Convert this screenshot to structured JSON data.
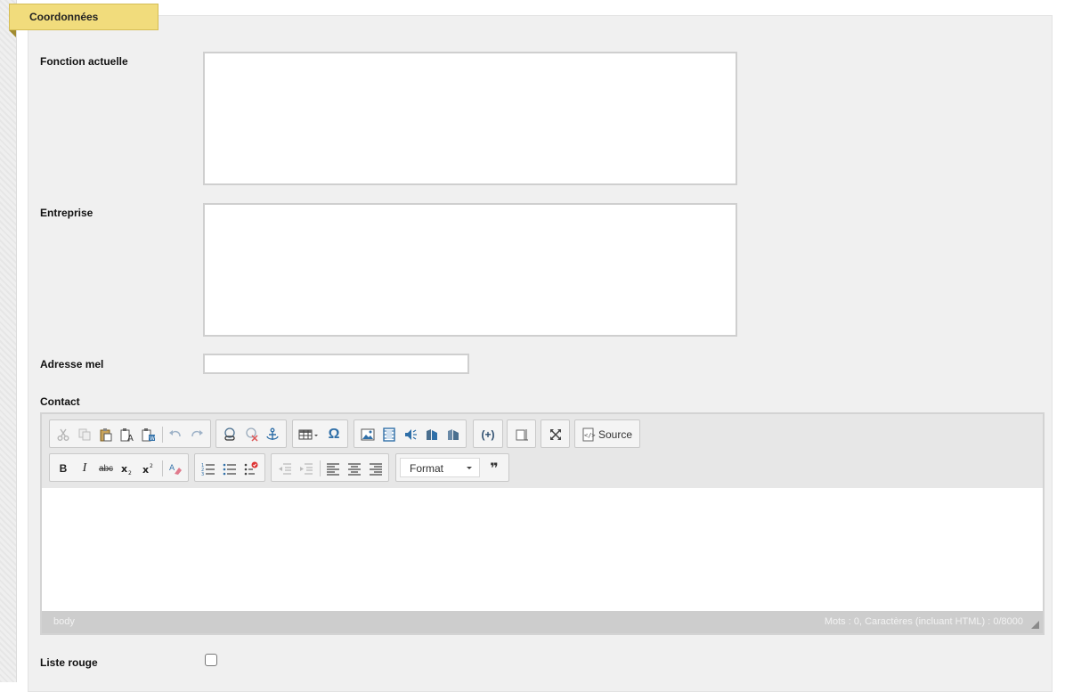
{
  "section": {
    "tab_label": "Coordonnées"
  },
  "fields": {
    "fonction_actuelle": {
      "label": "Fonction actuelle",
      "value": ""
    },
    "entreprise": {
      "label": "Entreprise",
      "value": ""
    },
    "adresse_mel": {
      "label": "Adresse mel",
      "value": ""
    },
    "contact": {
      "label": "Contact"
    },
    "liste_rouge": {
      "label": "Liste rouge",
      "checked": false
    }
  },
  "editor": {
    "toolbar": {
      "row1": [
        {
          "icon": "cut-icon",
          "enabled": false
        },
        {
          "icon": "copy-icon",
          "enabled": false
        },
        {
          "icon": "paste-icon",
          "enabled": true
        },
        {
          "icon": "paste-text-icon",
          "enabled": true
        },
        {
          "icon": "paste-word-icon",
          "enabled": true
        },
        {
          "icon": "undo-icon",
          "enabled": false
        },
        {
          "icon": "redo-icon",
          "enabled": false
        },
        {
          "icon": "link-icon",
          "enabled": true
        },
        {
          "icon": "unlink-icon",
          "enabled": true
        },
        {
          "icon": "anchor-icon",
          "enabled": true
        },
        {
          "icon": "table-icon",
          "enabled": true
        },
        {
          "icon": "special-char-icon",
          "enabled": true
        },
        {
          "icon": "image-icon",
          "enabled": true
        },
        {
          "icon": "video-icon",
          "enabled": true
        },
        {
          "icon": "audio-icon",
          "enabled": true
        },
        {
          "icon": "flash-icon",
          "enabled": true
        },
        {
          "icon": "document-icon",
          "enabled": true
        },
        {
          "icon": "placeholder-icon",
          "enabled": true
        },
        {
          "icon": "show-blocks-icon",
          "enabled": true
        },
        {
          "icon": "maximize-icon",
          "enabled": true
        },
        {
          "icon": "source-icon",
          "enabled": true
        }
      ],
      "source_label": "Source",
      "bold_glyph": "B",
      "italic_glyph": "I",
      "strike_glyph": "abc",
      "omega_glyph": "Ω",
      "placeholder_glyph": "(+)",
      "quote_glyph": "❞",
      "format_label": "Format"
    },
    "footer": {
      "path": "body",
      "wordcount": "Mots : 0, Caractères (incluant HTML) : 0/8000"
    }
  },
  "colors": {
    "tab_bg": "#f1dc7c",
    "panel_bg": "#f0f0f0",
    "icon_blue": "#2f6fa8",
    "footer_bg": "#cdcdcd"
  }
}
